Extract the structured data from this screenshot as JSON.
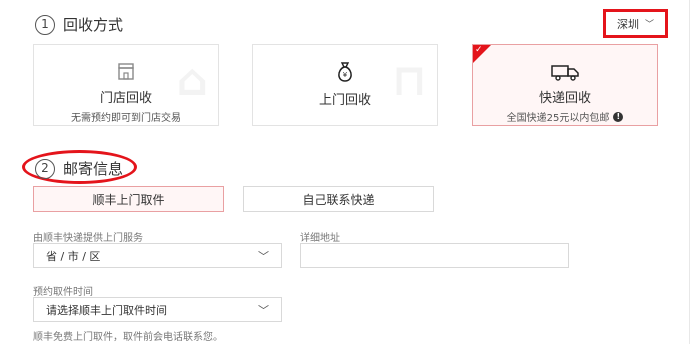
{
  "method_section": {
    "step": "1",
    "title": "回收方式",
    "city": "深圳",
    "cards": [
      {
        "name": "门店回收",
        "desc": "无需预约即可到门店交易",
        "icon": "store-icon"
      },
      {
        "name": "上门回收",
        "desc": "",
        "icon": "money-bag-icon"
      },
      {
        "name": "快递回收",
        "desc": "全国快递25元以内包邮",
        "icon": "truck-icon",
        "info": "!"
      }
    ]
  },
  "mail_section": {
    "step": "2",
    "title": "邮寄信息",
    "options": [
      "顺丰上门取件",
      "自己联系快递"
    ],
    "area_label": "由顺丰快递提供上门服务",
    "area_value": "省 / 市 / 区",
    "detail_label": "详细地址",
    "time_label": "预约取件时间",
    "time_value": "请选择顺丰上门取件时间",
    "note": "顺丰免费上门取件，取件前会电话联系您。"
  },
  "colors": {
    "accent": "#e4141b",
    "active_bg": "#fff6f6"
  }
}
